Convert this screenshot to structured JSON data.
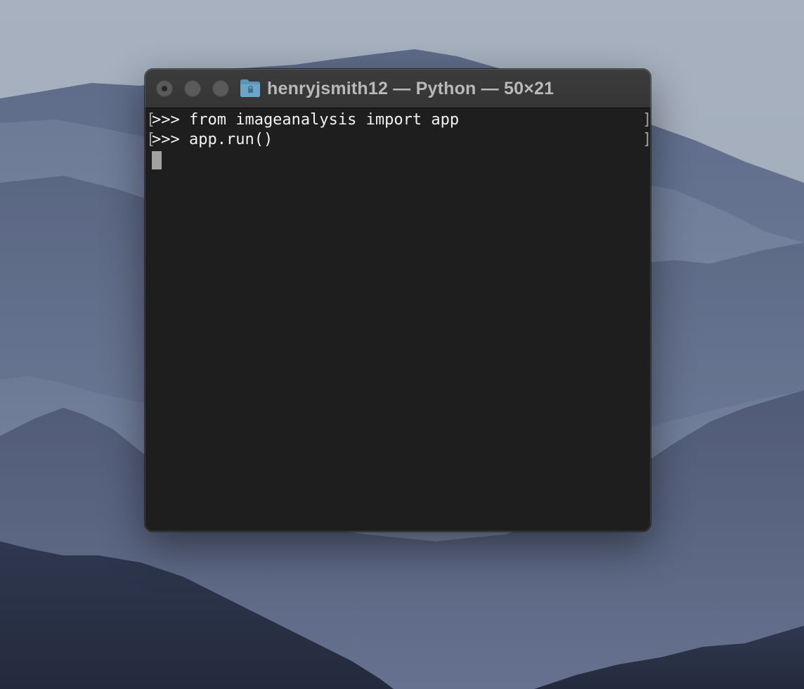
{
  "window": {
    "title": "henryjsmith12 — Python — 50×21",
    "title_icon": "folder-icon"
  },
  "terminal": {
    "lines": [
      {
        "open_mark": "[",
        "text": ">>> from imageanalysis import app",
        "close_mark": "]"
      },
      {
        "open_mark": "[",
        "text": ">>> app.run()",
        "close_mark": "]"
      }
    ]
  },
  "colors": {
    "terminal_background": "#1e1e1e",
    "titlebar_background": "#3a3a3a",
    "text": "#f2f2f2",
    "cursor": "#a2a2a2"
  }
}
